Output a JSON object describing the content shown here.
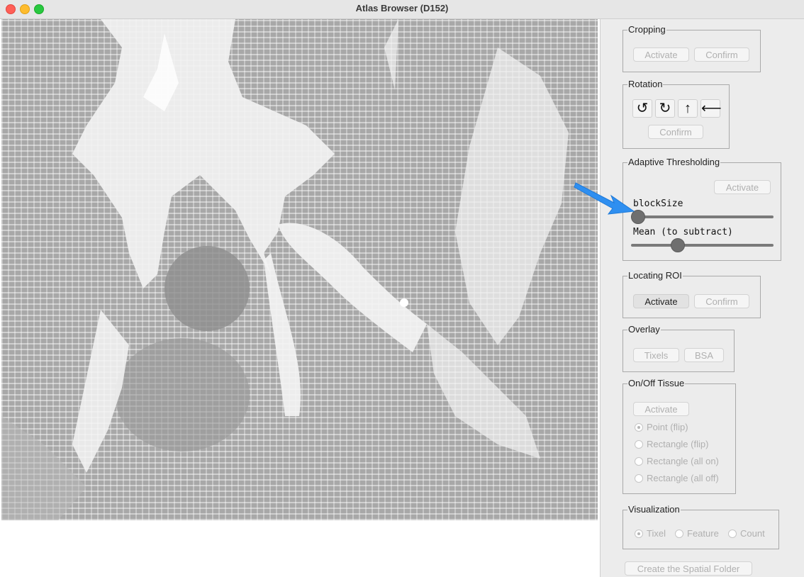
{
  "window": {
    "title": "Atlas Browser (D152)"
  },
  "cropping": {
    "title": "Cropping",
    "activate": "Activate",
    "confirm": "Confirm"
  },
  "rotation": {
    "title": "Rotation",
    "ccw_icon": "↺",
    "cw_icon": "↻",
    "up_icon": "↑",
    "left_icon": "⟵",
    "confirm": "Confirm"
  },
  "thresholding": {
    "title": "Adaptive Thresholding",
    "activate": "Activate",
    "block_label": "blockSize",
    "block_value": 0.0,
    "mean_label": "Mean (to subtract)",
    "mean_value": 0.31
  },
  "roi": {
    "title": "Locating ROI",
    "activate": "Activate",
    "confirm": "Confirm"
  },
  "overlay": {
    "title": "Overlay",
    "tixels": "Tixels",
    "bsa": "BSA"
  },
  "onoff": {
    "title": "On/Off Tissue",
    "activate": "Activate",
    "options": [
      "Point (flip)",
      "Rectangle (flip)",
      "Rectangle (all on)",
      "Rectangle (all off)"
    ],
    "selected": "Point (flip)"
  },
  "visualization": {
    "title": "Visualization",
    "options": [
      "Tixel",
      "Feature",
      "Count"
    ],
    "selected": "Tixel"
  },
  "footer": {
    "create": "Create the Spatial Folder"
  },
  "colors": {
    "accent_arrow": "#2f8ff0",
    "track": "#7a7a7a",
    "thumb": "#6f6f6f"
  }
}
